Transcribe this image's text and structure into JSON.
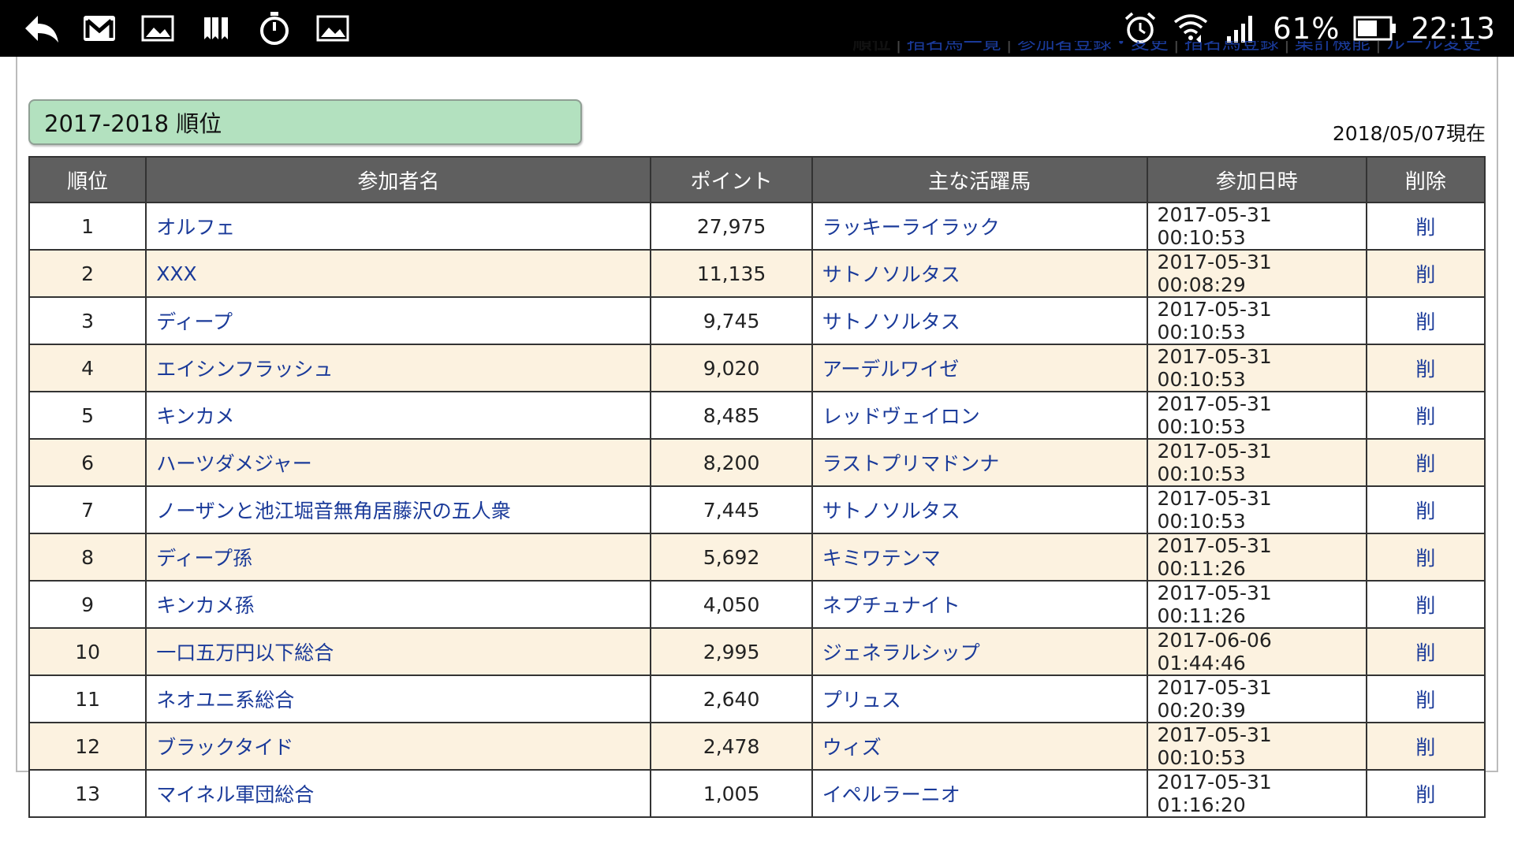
{
  "status_bar": {
    "battery": "61%",
    "time": "22:13"
  },
  "nav": {
    "items": [
      "順位",
      "指名馬一覧",
      "参加者登録・変更",
      "指名馬登録",
      "集計機能",
      "ルール変更"
    ]
  },
  "section": {
    "title": "2017-2018 順位",
    "as_of": "2018/05/07現在"
  },
  "table": {
    "headers": [
      "順位",
      "参加者名",
      "ポイント",
      "主な活躍馬",
      "参加日時",
      "削除"
    ],
    "rows": [
      {
        "rank": "1",
        "name": "オルフェ",
        "points": "27,975",
        "horse": "ラッキーライラック",
        "date": "2017-05-31 00:10:53",
        "del": "削"
      },
      {
        "rank": "2",
        "name": "XXX",
        "points": "11,135",
        "horse": "サトノソルタス",
        "date": "2017-05-31 00:08:29",
        "del": "削"
      },
      {
        "rank": "3",
        "name": "ディープ",
        "points": "9,745",
        "horse": "サトノソルタス",
        "date": "2017-05-31 00:10:53",
        "del": "削"
      },
      {
        "rank": "4",
        "name": "エイシンフラッシュ",
        "points": "9,020",
        "horse": "アーデルワイゼ",
        "date": "2017-05-31 00:10:53",
        "del": "削"
      },
      {
        "rank": "5",
        "name": "キンカメ",
        "points": "8,485",
        "horse": "レッドヴェイロン",
        "date": "2017-05-31 00:10:53",
        "del": "削"
      },
      {
        "rank": "6",
        "name": "ハーツダメジャー",
        "points": "8,200",
        "horse": "ラストプリマドンナ",
        "date": "2017-05-31 00:10:53",
        "del": "削"
      },
      {
        "rank": "7",
        "name": "ノーザンと池江堀音無角居藤沢の五人衆",
        "points": "7,445",
        "horse": "サトノソルタス",
        "date": "2017-05-31 00:10:53",
        "del": "削"
      },
      {
        "rank": "8",
        "name": "ディープ孫",
        "points": "5,692",
        "horse": "キミワテンマ",
        "date": "2017-05-31 00:11:26",
        "del": "削"
      },
      {
        "rank": "9",
        "name": "キンカメ孫",
        "points": "4,050",
        "horse": "ネプチュナイト",
        "date": "2017-05-31 00:11:26",
        "del": "削"
      },
      {
        "rank": "10",
        "name": "一口五万円以下総合",
        "points": "2,995",
        "horse": "ジェネラルシップ",
        "date": "2017-06-06 01:44:46",
        "del": "削"
      },
      {
        "rank": "11",
        "name": "ネオユニ系総合",
        "points": "2,640",
        "horse": "プリュス",
        "date": "2017-05-31 00:20:39",
        "del": "削"
      },
      {
        "rank": "12",
        "name": "ブラックタイド",
        "points": "2,478",
        "horse": "ウィズ",
        "date": "2017-05-31 00:10:53",
        "del": "削"
      },
      {
        "rank": "13",
        "name": "マイネル軍団総合",
        "points": "1,005",
        "horse": "イペルラーニオ",
        "date": "2017-05-31 01:16:20",
        "del": "削"
      }
    ]
  }
}
